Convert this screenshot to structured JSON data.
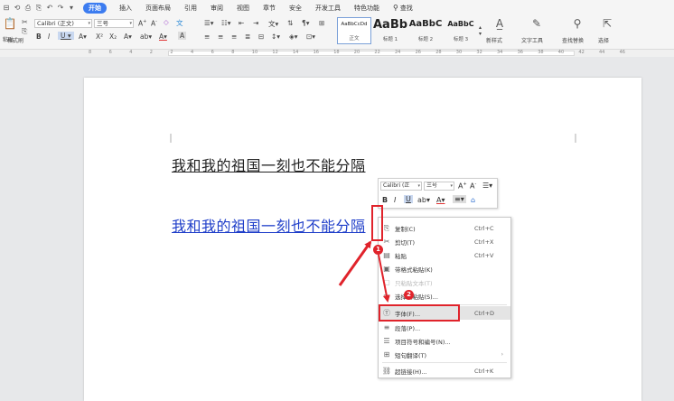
{
  "quick_access": [
    "⊟",
    "⟲",
    "⎙",
    "⎘",
    "↶",
    "↷",
    "▾"
  ],
  "menu": {
    "tabs": [
      "开始",
      "插入",
      "页面布局",
      "引用",
      "审阅",
      "视图",
      "章节",
      "安全",
      "开发工具",
      "特色功能"
    ],
    "active": "开始",
    "search": "查找"
  },
  "ribbon": {
    "paste_label": "粘贴",
    "format_painter_label": "格式刷",
    "font_name": "Calibri (正文)",
    "font_size": "三号",
    "styles": [
      {
        "sample": "AaBbCcDd",
        "name": "正文"
      },
      {
        "sample": "AaBb",
        "name": "标题 1"
      },
      {
        "sample": "AaBbC",
        "name": "标题 2"
      },
      {
        "sample": "AaBbC",
        "name": "标题 3"
      }
    ],
    "new_style_label": "新样式",
    "text_tools_label": "文字工具",
    "find_replace_label": "查找替换",
    "select_label": "选择"
  },
  "ruler": {
    "numbers": [
      "8",
      "6",
      "4",
      "2",
      "2",
      "4",
      "6",
      "8",
      "10",
      "12",
      "14",
      "16",
      "18",
      "20",
      "22",
      "24",
      "26",
      "28",
      "30",
      "32",
      "34",
      "36",
      "38",
      "40",
      "42",
      "44",
      "46"
    ]
  },
  "document": {
    "line1": "我和我的祖国一刻也不能分隔",
    "line2": "我和我的祖国一刻也不能分隔",
    "line2_color": "#1f3ec9"
  },
  "mini_toolbar": {
    "font_name": "Calibri (正",
    "font_size": "三号"
  },
  "context_menu": {
    "items": [
      {
        "icon": "⎘",
        "label": "复制(C)",
        "shortcut": "Ctrl+C"
      },
      {
        "icon": "✂",
        "label": "剪切(T)",
        "shortcut": "Ctrl+X"
      },
      {
        "icon": "▤",
        "label": "粘贴",
        "shortcut": "Ctrl+V"
      },
      {
        "icon": "▣",
        "label": "带格式粘贴(K)",
        "shortcut": ""
      },
      {
        "icon": "▢",
        "label": "只粘贴文本(T)",
        "shortcut": ""
      },
      {
        "icon": "▭",
        "label": "选择性粘贴(S)...",
        "shortcut": ""
      },
      {
        "icon": "Ⓣ",
        "label": "字体(F)...",
        "shortcut": "Ctrl+D"
      },
      {
        "icon": "≡",
        "label": "段落(P)...",
        "shortcut": ""
      },
      {
        "icon": "☰",
        "label": "项目符号和编号(N)...",
        "shortcut": ""
      },
      {
        "icon": "⊞",
        "label": "短句翻译(T)",
        "shortcut": ""
      },
      {
        "icon": "⛓",
        "label": "超链接(H)...",
        "shortcut": "Ctrl+K"
      }
    ]
  },
  "annotations": {
    "badge1": "1",
    "badge2": "2",
    "color": "#e0232b"
  }
}
